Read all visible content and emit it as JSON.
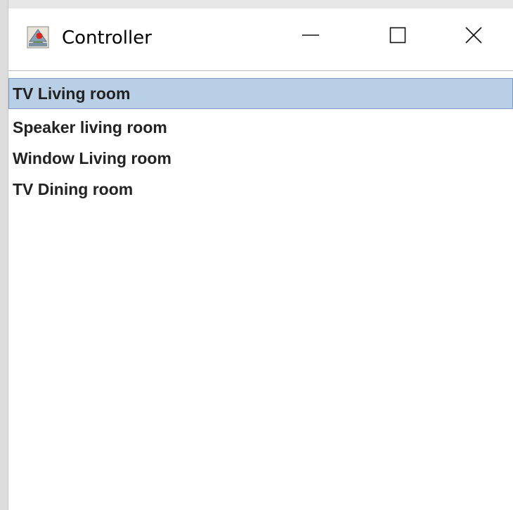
{
  "window": {
    "title": "Controller",
    "icon": "java-app-icon",
    "controls": {
      "minimize_icon": "minimize-icon",
      "maximize_icon": "maximize-icon",
      "close_icon": "close-icon"
    }
  },
  "list": {
    "selected_index": 0,
    "items": [
      {
        "label": "TV Living room"
      },
      {
        "label": "Speaker living room"
      },
      {
        "label": "Window Living room"
      },
      {
        "label": "TV Dining room"
      }
    ]
  },
  "colors": {
    "selection_bg": "#b8cfe6",
    "selection_border": "#7a9cc6",
    "text": "#222222"
  }
}
